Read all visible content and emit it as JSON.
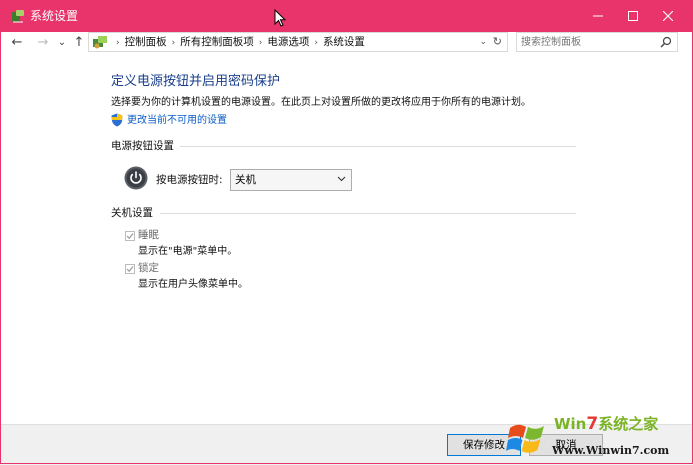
{
  "window": {
    "title": "系统设置",
    "accent": "#e8336b"
  },
  "address": {
    "back_icon": "←",
    "forward_icon": "→",
    "history_icon": "⌄",
    "up_icon": "↑",
    "crumbs": [
      "控制面板",
      "所有控制面板项",
      "电源选项",
      "系统设置"
    ],
    "search_placeholder": "搜索控制面板"
  },
  "page": {
    "heading": "定义电源按钮并启用密码保护",
    "description": "选择要为你的计算机设置的电源设置。在此页上对设置所做的更改将应用于你所有的电源计划。",
    "change_link": "更改当前不可用的设置"
  },
  "power_buttons": {
    "section_title": "电源按钮设置",
    "label": "按电源按钮时:",
    "selected": "关机"
  },
  "shutdown": {
    "section_title": "关机设置",
    "items": [
      {
        "label": "睡眠",
        "desc": "显示在\"电源\"菜单中。",
        "checked": true,
        "enabled": false
      },
      {
        "label": "锁定",
        "desc": "显示在用户头像菜单中。",
        "checked": true,
        "enabled": false
      }
    ]
  },
  "footer": {
    "save": "保存修改",
    "cancel": "取消"
  },
  "watermark": {
    "brand_prefix": "Win",
    "brand_seven": "7",
    "brand_suffix": "系统之家",
    "url": "Www.Winwin7.com"
  }
}
